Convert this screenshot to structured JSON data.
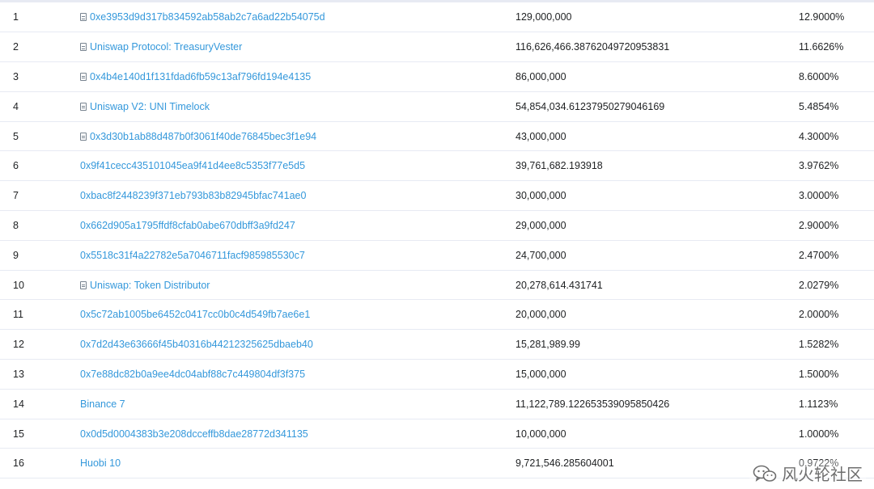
{
  "rows": [
    {
      "rank": "1",
      "address": "0xe3953d9d317b834592ab58ab2c7a6ad22b54075d",
      "contract": true,
      "quantity": "129,000,000",
      "percentage": "12.9000%"
    },
    {
      "rank": "2",
      "address": "Uniswap Protocol: TreasuryVester",
      "contract": true,
      "quantity": "116,626,466.38762049720953831",
      "percentage": "11.6626%"
    },
    {
      "rank": "3",
      "address": "0x4b4e140d1f131fdad6fb59c13af796fd194e4135",
      "contract": true,
      "quantity": "86,000,000",
      "percentage": "8.6000%"
    },
    {
      "rank": "4",
      "address": "Uniswap V2: UNI Timelock",
      "contract": true,
      "quantity": "54,854,034.61237950279046169",
      "percentage": "5.4854%"
    },
    {
      "rank": "5",
      "address": "0x3d30b1ab88d487b0f3061f40de76845bec3f1e94",
      "contract": true,
      "quantity": "43,000,000",
      "percentage": "4.3000%"
    },
    {
      "rank": "6",
      "address": "0x9f41cecc435101045ea9f41d4ee8c5353f77e5d5",
      "contract": false,
      "quantity": "39,761,682.193918",
      "percentage": "3.9762%"
    },
    {
      "rank": "7",
      "address": "0xbac8f2448239f371eb793b83b82945bfac741ae0",
      "contract": false,
      "quantity": "30,000,000",
      "percentage": "3.0000%"
    },
    {
      "rank": "8",
      "address": "0x662d905a1795ffdf8cfab0abe670dbff3a9fd247",
      "contract": false,
      "quantity": "29,000,000",
      "percentage": "2.9000%"
    },
    {
      "rank": "9",
      "address": "0x5518c31f4a22782e5a7046711facf985985530c7",
      "contract": false,
      "quantity": "24,700,000",
      "percentage": "2.4700%"
    },
    {
      "rank": "10",
      "address": "Uniswap: Token Distributor",
      "contract": true,
      "quantity": "20,278,614.431741",
      "percentage": "2.0279%"
    },
    {
      "rank": "11",
      "address": "0x5c72ab1005be6452c0417cc0b0c4d549fb7ae6e1",
      "contract": false,
      "quantity": "20,000,000",
      "percentage": "2.0000%"
    },
    {
      "rank": "12",
      "address": "0x7d2d43e63666f45b40316b44212325625dbaeb40",
      "contract": false,
      "quantity": "15,281,989.99",
      "percentage": "1.5282%"
    },
    {
      "rank": "13",
      "address": "0x7e88dc82b0a9ee4dc04abf88c7c449804df3f375",
      "contract": false,
      "quantity": "15,000,000",
      "percentage": "1.5000%"
    },
    {
      "rank": "14",
      "address": "Binance 7",
      "contract": false,
      "quantity": "11,122,789.122653539095850426",
      "percentage": "1.1123%"
    },
    {
      "rank": "15",
      "address": "0x0d5d0004383b3e208dcceffb8dae28772d341135",
      "contract": false,
      "quantity": "10,000,000",
      "percentage": "1.0000%"
    },
    {
      "rank": "16",
      "address": "Huobi 10",
      "contract": false,
      "quantity": "9,721,546.285604001",
      "percentage": "0.9722%"
    }
  ],
  "watermark": {
    "text": "风火轮社区",
    "icon": "wechat-icon"
  },
  "colors": {
    "link": "#3498db",
    "text": "#1e2022",
    "border": "#e7eaf3"
  }
}
